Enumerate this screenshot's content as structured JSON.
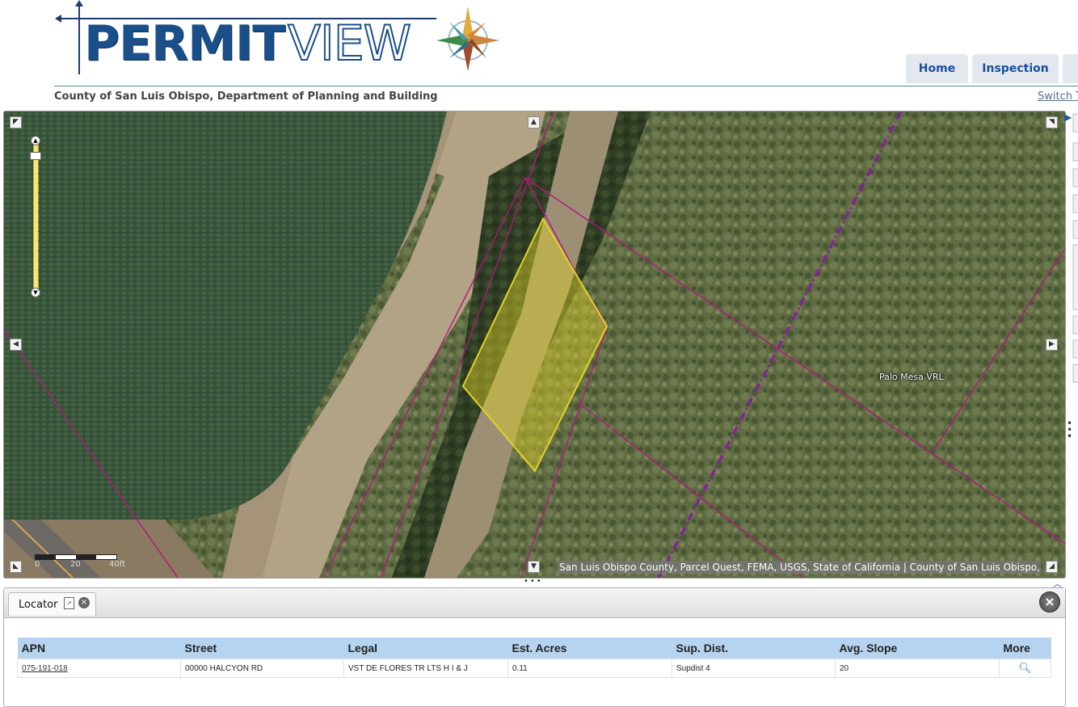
{
  "header": {
    "logo_permit": "PERMIT",
    "logo_view": "VIEW",
    "nav": [
      {
        "label": "Home"
      },
      {
        "label": "Inspection"
      }
    ],
    "department": "County of San Luis Obispo, Department of Planning and Building",
    "switch_link": "Switch T"
  },
  "map": {
    "place_label": "Palo Mesa VRL",
    "attribution": "San Luis Obispo County, Parcel Quest, FEMA, USGS, State of California | County of San Luis Obispo,...",
    "scale_labels": [
      "0",
      "20",
      "40ft"
    ],
    "colors": {
      "parcel_line": "#b2187d",
      "selected_parcel": "#e1d328",
      "district_line": "#8a1aa8"
    }
  },
  "locator": {
    "tab_label": "Locator",
    "columns": [
      "APN",
      "Street",
      "Legal",
      "Est. Acres",
      "Sup. Dist.",
      "Avg. Slope",
      "More"
    ],
    "rows": [
      {
        "apn": "075-191-018",
        "street": "00000 HALCYON RD",
        "legal": "VST DE FLORES TR LTS H I & J",
        "acres": "0.11",
        "sup_dist": "Supdist 4",
        "avg_slope": "20",
        "more_icon": "magnifier-icon"
      }
    ]
  }
}
